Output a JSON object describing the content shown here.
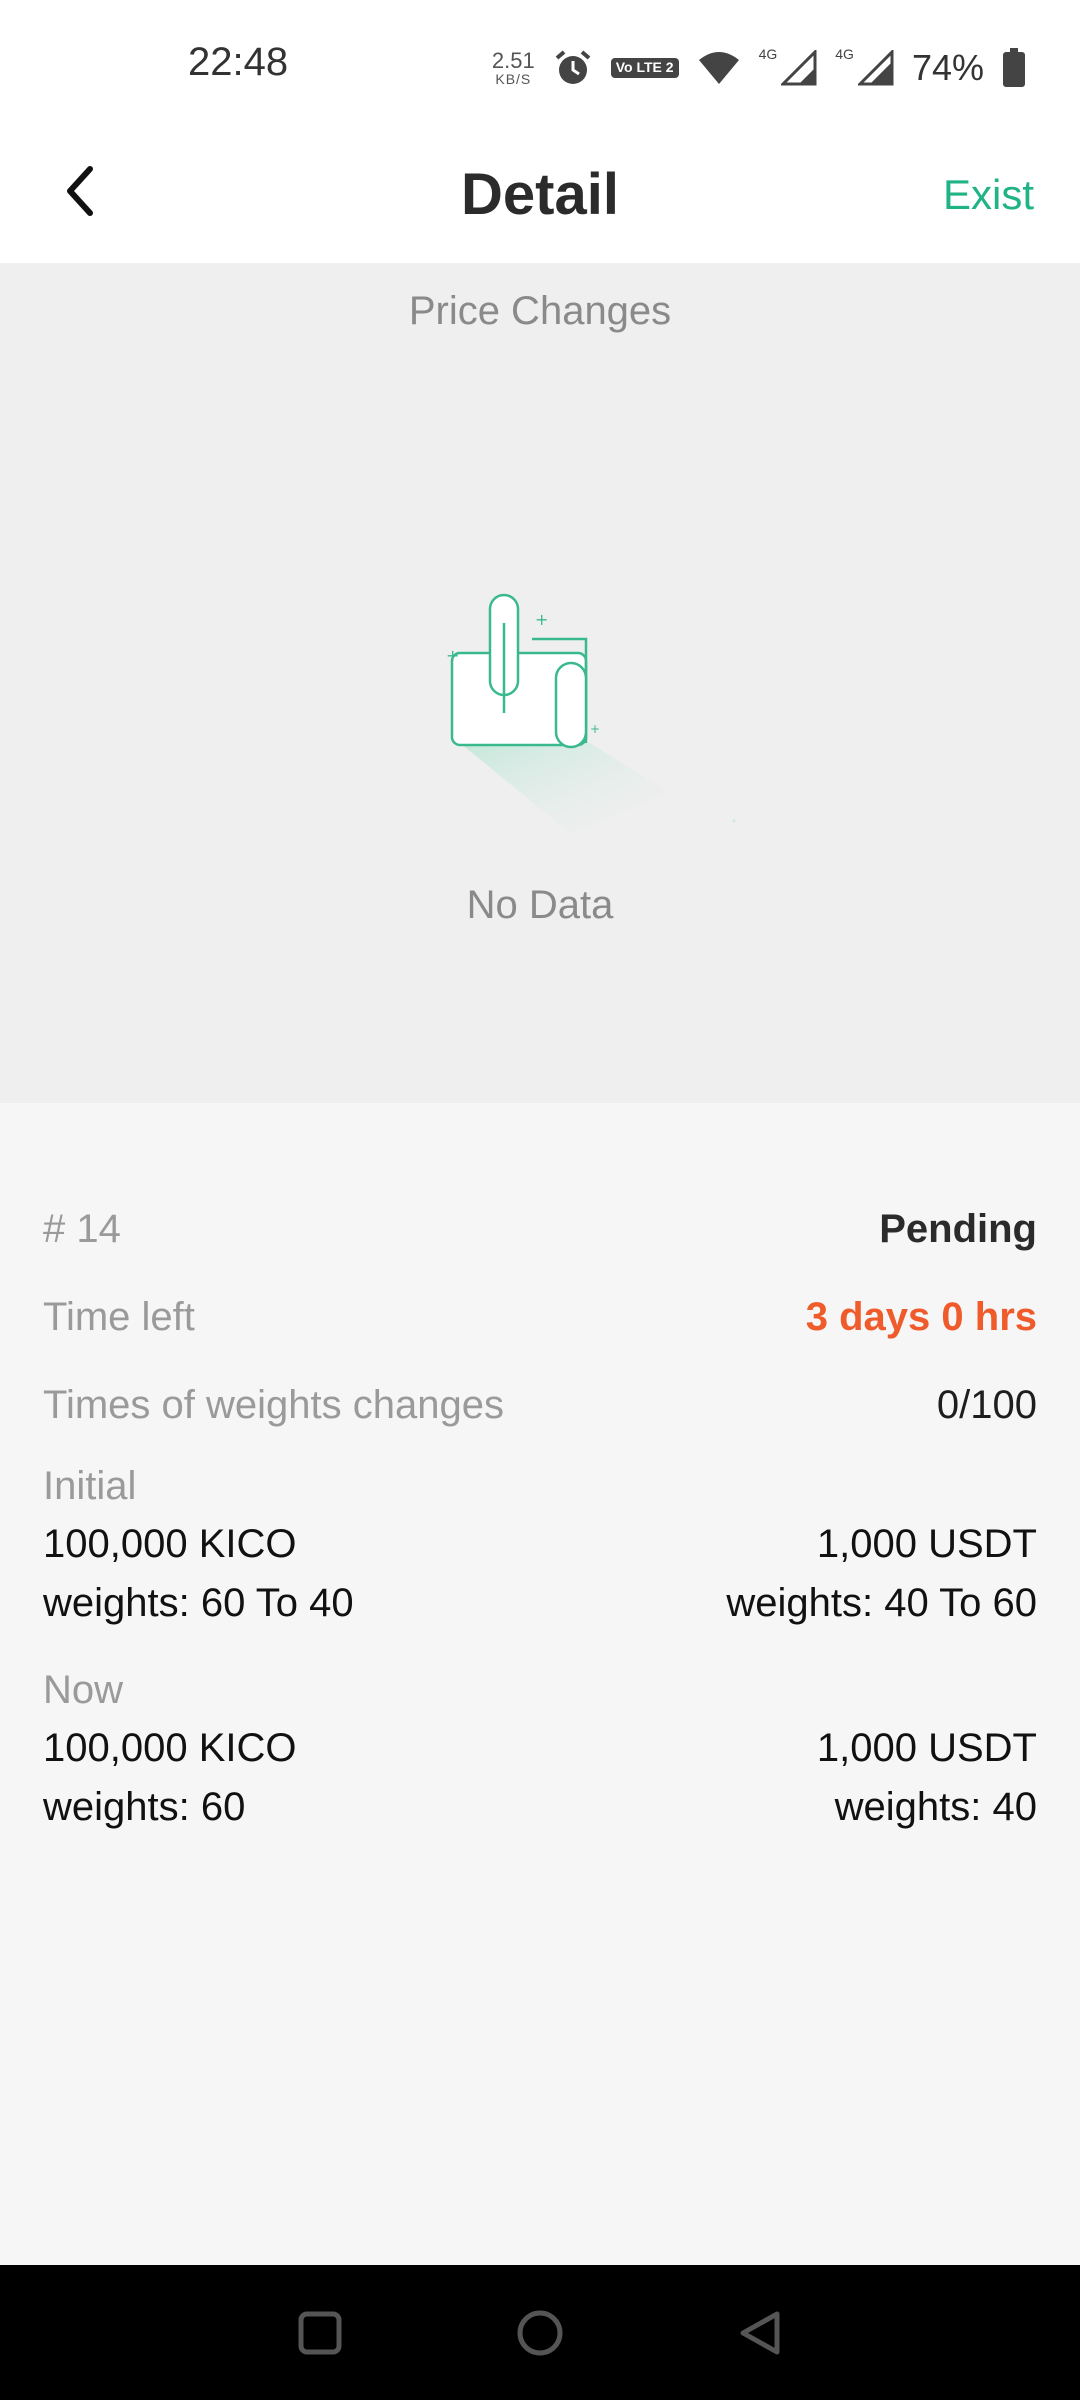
{
  "status_bar": {
    "time": "22:48",
    "net_speed_value": "2.51",
    "net_speed_unit": "KB/S",
    "volte_label": "Vo LTE 2",
    "network_1": "4G",
    "network_2": "4G",
    "battery": "74%",
    "icons": [
      "alarm-icon",
      "volte-icon",
      "wifi-icon",
      "signal-icon",
      "signal-icon",
      "battery-icon"
    ]
  },
  "header": {
    "title": "Detail",
    "action_label": "Exist",
    "back_icon": "chevron-left-icon"
  },
  "chart": {
    "title": "Price Changes",
    "empty_text": "No Data",
    "illustration": "empty-document-icon"
  },
  "details": {
    "id_label": "# 14",
    "status": "Pending",
    "time_left_label": "Time left",
    "time_left_value": "3 days 0 hrs",
    "weight_changes_label": "Times of weights changes",
    "weight_changes_value": "0/100",
    "initial": {
      "label": "Initial",
      "left_amount": "100,000 KICO",
      "left_weights": "weights: 60 To 40",
      "right_amount": "1,000 USDT",
      "right_weights": "weights: 40 To 60"
    },
    "now": {
      "label": "Now",
      "left_amount": "100,000 KICO",
      "left_weights": "weights: 60",
      "right_amount": "1,000 USDT",
      "right_weights": "weights: 40"
    }
  },
  "colors": {
    "accent": "#1fb386",
    "warning": "#ef5b2b",
    "background": "#f6f6f6",
    "chart_background": "#efefef"
  },
  "nav_bar": {
    "buttons": [
      "recents-icon",
      "home-icon",
      "back-icon"
    ]
  }
}
